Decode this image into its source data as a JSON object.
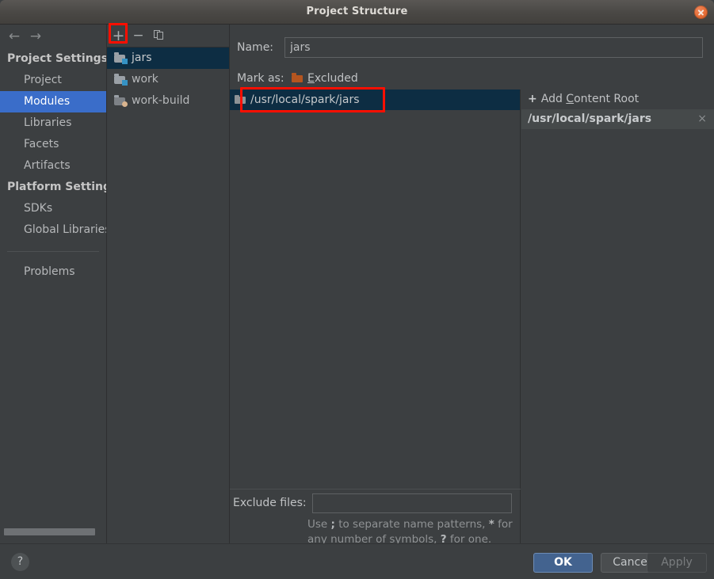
{
  "window": {
    "title": "Project Structure",
    "close_icon": "close-icon"
  },
  "sidebar": {
    "nav": {
      "back_icon": "←",
      "forward_icon": "→"
    },
    "groups": [
      {
        "label": "Project Settings",
        "items": [
          {
            "label": "Project",
            "selected": false
          },
          {
            "label": "Modules",
            "selected": true
          },
          {
            "label": "Libraries",
            "selected": false
          },
          {
            "label": "Facets",
            "selected": false
          },
          {
            "label": "Artifacts",
            "selected": false
          }
        ]
      },
      {
        "label": "Platform Settings",
        "items": [
          {
            "label": "SDKs",
            "selected": false
          },
          {
            "label": "Global Libraries",
            "selected": false
          }
        ]
      }
    ],
    "problems_label": "Problems"
  },
  "modules_panel": {
    "toolbar": {
      "add_label": "+",
      "remove_label": "−",
      "copy_icon": "copy-icon"
    },
    "items": [
      {
        "label": "jars",
        "selected": true,
        "badge": "square"
      },
      {
        "label": "work",
        "selected": false,
        "badge": "square"
      },
      {
        "label": "work-build",
        "selected": false,
        "badge": "round"
      }
    ]
  },
  "content": {
    "name_label": "Name:",
    "name_value": "jars",
    "mark_as_label": "Mark as:",
    "mark_as_action_prefix": "E",
    "mark_as_action_rest": "xcluded",
    "content_roots": [
      {
        "path": "/usr/local/spark/jars",
        "selected": true
      }
    ],
    "add_content_root": {
      "plus": "+",
      "text_prefix": "Add ",
      "mnemonic": "C",
      "text_rest": "ontent Root"
    },
    "root_entry": {
      "path": "/usr/local/spark/jars",
      "remove_icon": "×"
    },
    "exclude_label": "Exclude files:",
    "exclude_value": "",
    "exclude_hint_1": "Use ",
    "exclude_hint_semicolon": ";",
    "exclude_hint_2": " to separate name patterns, ",
    "exclude_hint_star": "*",
    "exclude_hint_3": " for any number of symbols, ",
    "exclude_hint_question": "?",
    "exclude_hint_4": " for one."
  },
  "footer": {
    "help_label": "?",
    "ok_label": "OK",
    "cancel_label": "Cancel",
    "apply_label": "Apply"
  },
  "colors": {
    "selection_blue": "#3a6dc9",
    "list_selection_navy": "#0d2d43",
    "annotation_red": "#fe0f00",
    "excluded_orange": "#b5551f",
    "module_badge_blue": "#3592c4",
    "module_badge_tan": "#d9b48f",
    "panel_bg": "#3c3f41"
  }
}
